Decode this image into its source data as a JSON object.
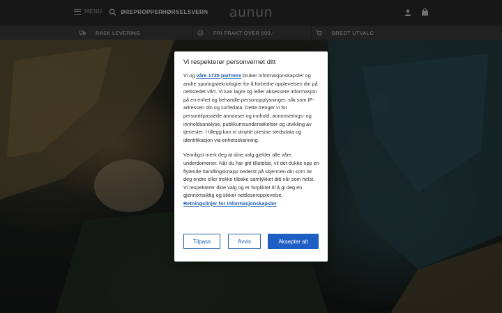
{
  "header": {
    "menu_label": "MENU",
    "nav": [
      "ØREPROPPER",
      "HØRSELSVERN"
    ],
    "logo_text": "aunun"
  },
  "usp": [
    {
      "label": "RASK LEVERING",
      "icon": "truck-icon"
    },
    {
      "label": "FRI FRAKT OVER 500,-",
      "icon": "badge-check-icon"
    },
    {
      "label": "BREDT UTVALG",
      "icon": "cart-icon"
    }
  ],
  "consent": {
    "title": "Vi respekterer personvernet ditt",
    "p1_pre": "Vi og ",
    "p1_link": "våre 1725 partnere",
    "p1_post": " bruker informasjonskapsler og andre sporingsteknologier for å forbedre opplevelsen din på nettstedet vårt. Vi kan lagre og /eller aksessere informasjon på en enhet og behandle personopplysninger, slik som IP-adressen din og surfedata. Dette trenger vi for persontilpassede annonser og innhold, annonserings- og innholdsanalyse, publikumsundersøkelser og utvikling av tjenester. I tillegg kan vi utnytte presise stedsdata og identifikasjon via enhetsskanning.",
    "p2": "Vennligst merk deg at dine valg gjelder alle våre underdomener. Når du har gitt tillatelse, vil det dukke opp en flytende handlingsknapp nederst på skjermen din som lar deg endre eller trekke tilbake samtykket ditt når som helst. Vi respekterer dine valg og er forpliktet til å gi deg en gjennomsiktig og sikker nettleseropplevelse.",
    "policy_link": "Retningslinjer for informasjonskapsler",
    "buttons": {
      "customize": "Tilpass",
      "reject": "Avvis",
      "accept": "Aksepter alt"
    }
  },
  "colors": {
    "accent": "#1f5fc4",
    "header_bg": "#2a2b2b",
    "usp_bg": "#3c3d3d"
  }
}
